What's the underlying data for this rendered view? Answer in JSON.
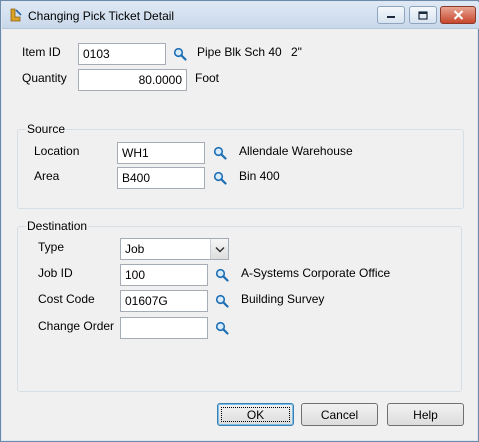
{
  "window": {
    "title": "Changing Pick Ticket Detail"
  },
  "item": {
    "id_label": "Item ID",
    "id_value": "0103",
    "description": "Pipe Blk Sch 40",
    "size": "2\"",
    "quantity_label": "Quantity",
    "quantity_value": "80.0000",
    "unit": "Foot"
  },
  "source": {
    "title": "Source",
    "location_label": "Location",
    "location_value": "WH1",
    "location_desc": "Allendale Warehouse",
    "area_label": "Area",
    "area_value": "B400",
    "area_desc": "Bin 400"
  },
  "destination": {
    "title": "Destination",
    "type_label": "Type",
    "type_value": "Job",
    "job_label": "Job ID",
    "job_value": "100",
    "job_desc": "A-Systems Corporate Office",
    "cost_label": "Cost Code",
    "cost_value": "01607G",
    "cost_desc": "Building Survey",
    "change_label": "Change Order",
    "change_value": ""
  },
  "buttons": {
    "ok": "OK",
    "cancel": "Cancel",
    "help": "Help"
  },
  "icons": {
    "lookup": "magnifier-icon",
    "accent": "#1f6fb5"
  }
}
